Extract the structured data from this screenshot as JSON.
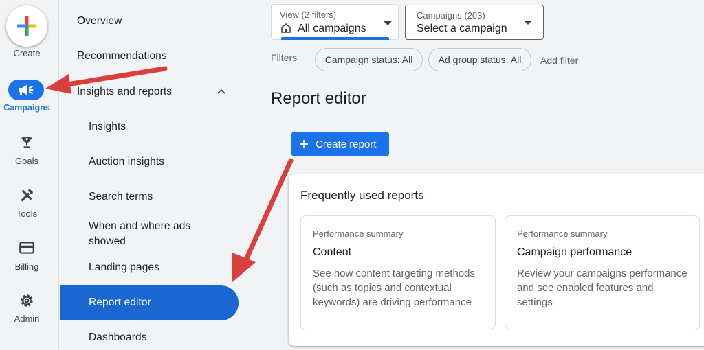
{
  "rail": {
    "create_label": "Create",
    "items": [
      {
        "label": "Campaigns",
        "icon": "megaphone-icon",
        "active": true
      },
      {
        "label": "Goals",
        "icon": "trophy-icon"
      },
      {
        "label": "Tools",
        "icon": "tools-icon"
      },
      {
        "label": "Billing",
        "icon": "credit-card-icon"
      },
      {
        "label": "Admin",
        "icon": "gear-icon"
      }
    ]
  },
  "nav": {
    "overview": "Overview",
    "recommendations": "Recommendations",
    "insights_reports": "Insights and reports",
    "insights": "Insights",
    "auction_insights": "Auction insights",
    "search_terms": "Search terms",
    "when_where_line1": "When and where ads",
    "when_where_line2": "showed",
    "landing_pages": "Landing pages",
    "report_editor": "Report editor",
    "dashboards": "Dashboards"
  },
  "header": {
    "view_small": "View (2 filters)",
    "view_value": "All campaigns",
    "campaigns_small": "Campaigns (203)",
    "campaigns_value": "Select a campaign"
  },
  "filters": {
    "label": "Filters",
    "campaign_status": "Campaign status: All",
    "ad_group_status": "Ad group status: All",
    "add_filter": "Add filter"
  },
  "main": {
    "title": "Report editor",
    "create_report": "Create report"
  },
  "frequent": {
    "title": "Frequently used reports",
    "reports": [
      {
        "category": "Performance summary",
        "name": "Content",
        "desc_lines": [
          "See how content targeting methods",
          "(such as topics and contextual",
          "keywords) are driving performance"
        ]
      },
      {
        "category": "Performance summary",
        "name": "Campaign performance",
        "desc_lines": [
          "Review your campaigns performance",
          "and see enabled features and",
          "settings"
        ]
      }
    ]
  },
  "colors": {
    "accent": "#1a73e8",
    "active_nav": "#1a67d2",
    "annotation_arrow": "#d93f3b"
  }
}
